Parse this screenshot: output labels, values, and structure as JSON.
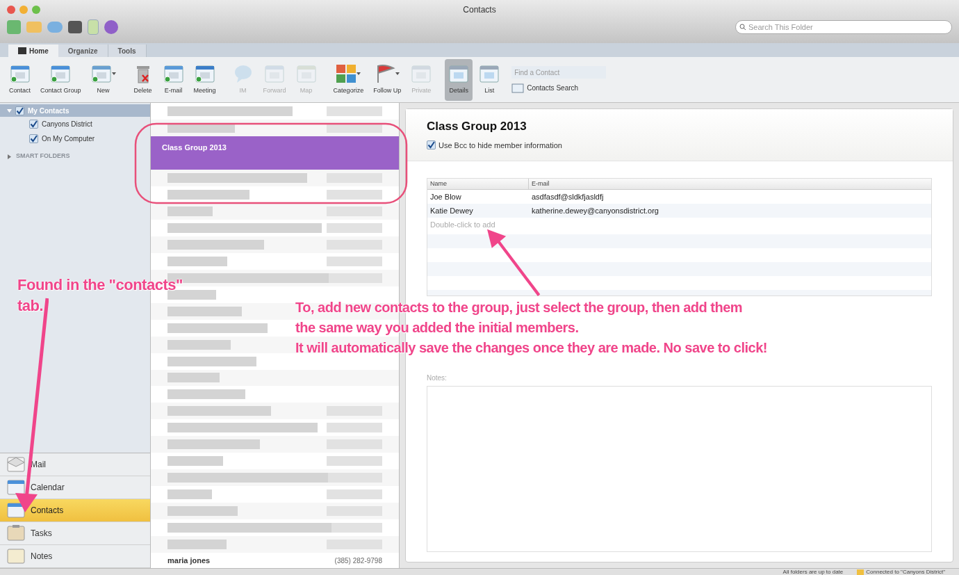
{
  "window": {
    "title": "Contacts"
  },
  "search": {
    "placeholder": "Search This Folder"
  },
  "tabs": [
    {
      "label": "Home",
      "selected": true
    },
    {
      "label": "Organize",
      "selected": false
    },
    {
      "label": "Tools",
      "selected": false
    }
  ],
  "ribbon": {
    "buttons": [
      {
        "label": "Contact",
        "disabled": false,
        "selected": false,
        "menu": false
      },
      {
        "label": "Contact Group",
        "disabled": false,
        "selected": false,
        "menu": false
      },
      {
        "label": "New",
        "disabled": false,
        "selected": false,
        "menu": true
      },
      {
        "label": "Delete",
        "disabled": false,
        "selected": false,
        "menu": false
      },
      {
        "label": "E-mail",
        "disabled": false,
        "selected": false,
        "menu": false
      },
      {
        "label": "Meeting",
        "disabled": false,
        "selected": false,
        "menu": false
      },
      {
        "label": "IM",
        "disabled": true,
        "selected": false,
        "menu": false
      },
      {
        "label": "Forward",
        "disabled": true,
        "selected": false,
        "menu": false
      },
      {
        "label": "Map",
        "disabled": true,
        "selected": false,
        "menu": false
      },
      {
        "label": "Categorize",
        "disabled": false,
        "selected": false,
        "menu": true
      },
      {
        "label": "Follow Up",
        "disabled": false,
        "selected": false,
        "menu": true
      },
      {
        "label": "Private",
        "disabled": true,
        "selected": false,
        "menu": false
      },
      {
        "label": "Details",
        "disabled": false,
        "selected": true,
        "menu": false
      },
      {
        "label": "List",
        "disabled": false,
        "selected": false,
        "menu": false
      }
    ],
    "find_contact": {
      "placeholder": "Find a Contact"
    },
    "contacts_search": "Contacts Search"
  },
  "sidebar": {
    "folders": [
      {
        "label": "My Contacts",
        "checked": true,
        "selected": true,
        "expanded": true,
        "children": [
          {
            "label": "Canyons District",
            "checked": true,
            "selected": false
          },
          {
            "label": "On My Computer",
            "checked": true,
            "selected": false
          }
        ]
      }
    ],
    "smart_folders": {
      "label": "SMART FOLDERS",
      "expanded": false
    }
  },
  "nav": [
    {
      "label": "Mail",
      "selected": false
    },
    {
      "label": "Calendar",
      "selected": false
    },
    {
      "label": "Contacts",
      "selected": true
    },
    {
      "label": "Tasks",
      "selected": false
    },
    {
      "label": "Notes",
      "selected": false
    }
  ],
  "list": {
    "rows": [
      {
        "kind": "blurred"
      },
      {
        "kind": "blurred"
      },
      {
        "kind": "group",
        "name": "Class Group 2013",
        "selected": true
      },
      {
        "kind": "blurred"
      },
      {
        "kind": "blurred"
      },
      {
        "kind": "blurred"
      },
      {
        "kind": "blurred"
      },
      {
        "kind": "blurred"
      },
      {
        "kind": "blurred"
      },
      {
        "kind": "blurred"
      },
      {
        "kind": "blurred"
      },
      {
        "kind": "blurred"
      },
      {
        "kind": "blurred"
      },
      {
        "kind": "blurred"
      },
      {
        "kind": "blurred"
      },
      {
        "kind": "blurred"
      },
      {
        "kind": "blurred"
      },
      {
        "kind": "blurred"
      },
      {
        "kind": "blurred"
      },
      {
        "kind": "blurred"
      },
      {
        "kind": "blurred"
      },
      {
        "kind": "blurred"
      },
      {
        "kind": "blurred"
      },
      {
        "kind": "blurred"
      },
      {
        "kind": "blurred"
      },
      {
        "kind": "blurred"
      },
      {
        "kind": "contact",
        "name": "maria jones",
        "phone": "(385) 282-9798"
      }
    ]
  },
  "detail": {
    "title": "Class Group 2013",
    "bcc": {
      "label": "Use Bcc to hide member information",
      "checked": true
    },
    "members": {
      "columns": [
        "Name",
        "E-mail"
      ],
      "rows": [
        [
          "Joe Blow",
          "asdfasdf@sldkfjasldfj"
        ],
        [
          "Katie Dewey",
          "katherine.dewey@canyonsdistrict.org"
        ]
      ],
      "placeholder": "Double-click to add"
    },
    "notes_label": "Notes:"
  },
  "status_bar": {
    "sync": "All folders are up to date",
    "connection": "Connected to \"Canyons District\""
  },
  "annotations": [
    {
      "kind": "left",
      "lines": [
        "Found in the \"contacts\"",
        "tab."
      ]
    },
    {
      "kind": "right",
      "lines": [
        "To, add new contacts to the group, just select the group, then add them",
        "the same way you added the initial members.",
        "It will automatically save the changes once they are made.  No save to click!"
      ]
    }
  ]
}
